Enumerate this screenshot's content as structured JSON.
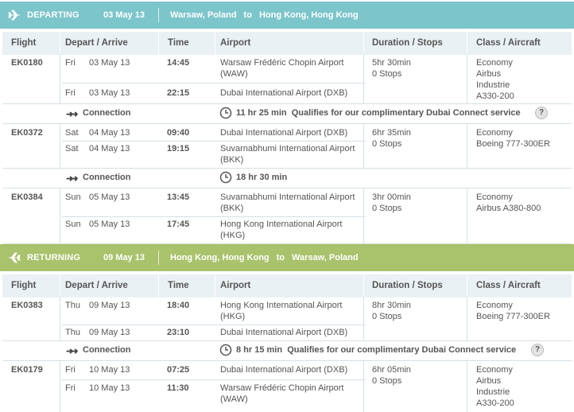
{
  "departing": {
    "label": "DEPARTING",
    "date": "03 May 13",
    "from": "Warsaw, Poland",
    "to_word": "to",
    "to": "Hong Kong, Hong Kong",
    "icon": "plane-icon"
  },
  "returning": {
    "label": "RETURNING",
    "date": "09 May 13",
    "from": "Hong Kong, Hong Kong",
    "to_word": "to",
    "to": "Warsaw, Poland",
    "icon": "plane-icon"
  },
  "columns": {
    "flight": "Flight",
    "depart_arrive": "Depart / Arrive",
    "time": "Time",
    "airport": "Airport",
    "duration": "Duration / Stops",
    "class": "Class / Aircraft"
  },
  "dep_flights": [
    {
      "number": "EK0180",
      "dep": {
        "day": "Fri",
        "date": "03 May 13",
        "time": "14:45",
        "airport": [
          "Warsaw Frédéric Chopin Airport",
          "(WAW)"
        ]
      },
      "arr": {
        "day": "Fri",
        "date": "03 May 13",
        "time": "22:15",
        "airport": [
          "Dubai International Airport (DXB)"
        ]
      },
      "duration": "5hr 30min",
      "stops": "0 Stops",
      "class_aircraft": [
        "Economy",
        "Airbus",
        "Industrie",
        "A330-200"
      ]
    },
    {
      "number": "EK0372",
      "dep": {
        "day": "Sat",
        "date": "04 May 13",
        "time": "09:40",
        "airport": [
          "Dubai International Airport (DXB)"
        ]
      },
      "arr": {
        "day": "Sat",
        "date": "04 May 13",
        "time": "19:15",
        "airport": [
          "Suvarnabhumi International Airport",
          "(BKK)"
        ]
      },
      "duration": "6hr 35min",
      "stops": "0 Stops",
      "class_aircraft": [
        "Economy",
        "Boeing 777-300ER"
      ]
    },
    {
      "number": "EK0384",
      "dep": {
        "day": "Sun",
        "date": "05 May 13",
        "time": "13:45",
        "airport": [
          "Suvarnabhumi International Airport",
          "(BKK)"
        ]
      },
      "arr": {
        "day": "Sun",
        "date": "05 May 13",
        "time": "17:45",
        "airport": [
          "Hong Kong International Airport",
          "(HKG)"
        ]
      },
      "duration": "3hr 00min",
      "stops": "0 Stops",
      "class_aircraft": [
        "Economy",
        "Airbus A380-800"
      ]
    }
  ],
  "dep_connections": [
    {
      "label": "Connection",
      "duration": "11 hr 25 min",
      "note": "Qualifies for our complimentary Dubai Connect service",
      "help": "?"
    },
    {
      "label": "Connection",
      "duration": "18 hr 30 min",
      "note": "",
      "help": ""
    }
  ],
  "ret_flights": [
    {
      "number": "EK0383",
      "dep": {
        "day": "Thu",
        "date": "09 May 13",
        "time": "18:40",
        "airport": [
          "Hong Kong International Airport",
          "(HKG)"
        ]
      },
      "arr": {
        "day": "Thu",
        "date": "09 May 13",
        "time": "23:10",
        "airport": [
          "Dubai International Airport (DXB)"
        ]
      },
      "duration": "8hr 30min",
      "stops": "0 Stops",
      "class_aircraft": [
        "Economy",
        "Boeing 777-300ER"
      ]
    },
    {
      "number": "EK0179",
      "dep": {
        "day": "Fri",
        "date": "10 May 13",
        "time": "07:25",
        "airport": [
          "Dubai International Airport (DXB)"
        ]
      },
      "arr": {
        "day": "Fri",
        "date": "10 May 13",
        "time": "11:30",
        "airport": [
          "Warsaw Frédéric Chopin Airport",
          "(WAW)"
        ]
      },
      "duration": "6hr 05min",
      "stops": "0 Stops",
      "class_aircraft": [
        "Economy",
        "Airbus",
        "Industrie",
        "A330-200"
      ]
    }
  ],
  "ret_connections": [
    {
      "label": "Connection",
      "duration": "8 hr 15 min",
      "note": "Qualifies for our complimentary Dubai Connect service",
      "help": "?"
    }
  ]
}
